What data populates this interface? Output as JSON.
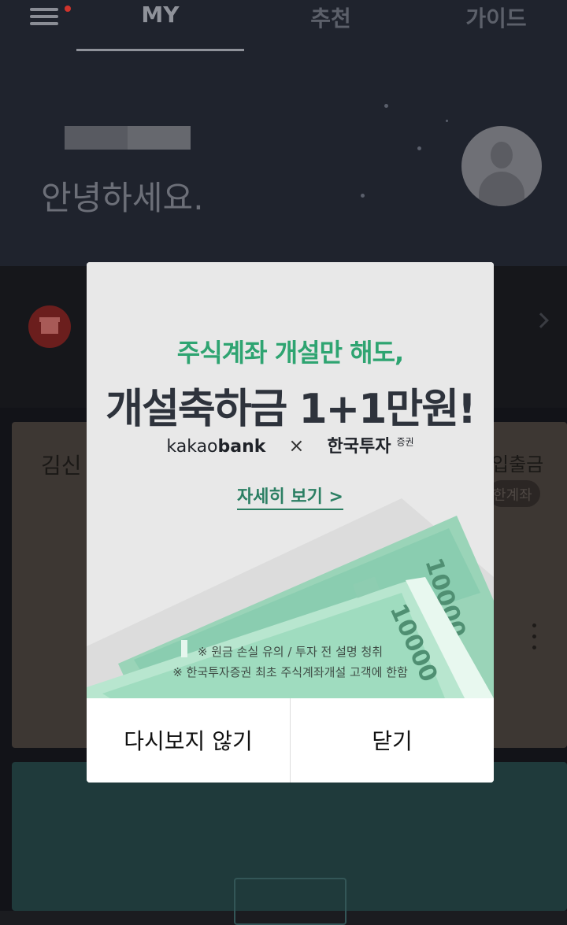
{
  "header": {
    "tabs": [
      "MY",
      "추천",
      "가이드"
    ],
    "active_tab": "MY",
    "notification_dot_color": "#d0342c"
  },
  "hero": {
    "greeting": "안녕하세요."
  },
  "cards": {
    "account_title_partial": "김신",
    "account_action_partial": "입출금",
    "account_badge_partial": "한계좌"
  },
  "modal": {
    "headline_top": "주식계좌 개설만 해도,",
    "headline_main": "개설축하금 1+1만원!",
    "partner_left_light": "kakao",
    "partner_left_bold": "bank",
    "partner_cross": "×",
    "partner_right": "한국투자",
    "partner_right_sup": "증권",
    "detail_link": "자세히 보기 >",
    "banknote_value": "10000",
    "disclaimer_1": "※ 원금 손실 유의 / 투자 전 설명 청취",
    "disclaimer_2": "※ 한국투자증권 최초 주식계좌개설 고객에 한함",
    "button_dont_show": "다시보지 않기",
    "button_close": "닫기",
    "accent_color": "#2ea471"
  }
}
